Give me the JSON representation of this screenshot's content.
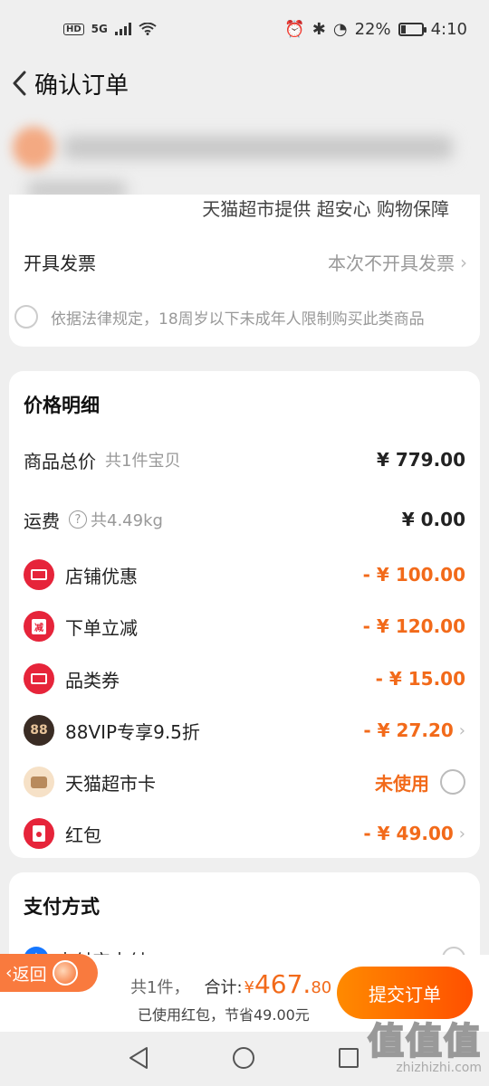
{
  "status_bar": {
    "left_badge": "HD",
    "network": "5G",
    "battery": "22%",
    "time": "4:10"
  },
  "header": {
    "title": "确认订单"
  },
  "card1": {
    "tmall_note": "天猫超市提供 超安心 购物保障",
    "invoice_label": "开具发票",
    "invoice_value": "本次不开具发票",
    "legal_text": "依据法律规定，18周岁以下未成年人限制购买此类商品"
  },
  "price_detail": {
    "title": "价格明细",
    "goods_total": {
      "label": "商品总价",
      "sub": "共1件宝贝",
      "value": "¥ 779.00"
    },
    "shipping": {
      "label": "运费",
      "sub": "共4.49kg",
      "value": "¥ 0.00"
    },
    "discounts": [
      {
        "label": "店铺优惠",
        "value": "- ¥ 100.00",
        "icon": "ticket-icon"
      },
      {
        "label": "下单立减",
        "value": "- ¥ 120.00",
        "icon": "jian-icon",
        "icon_text": "减"
      },
      {
        "label": "品类券",
        "value": "- ¥ 15.00",
        "icon": "ticket-icon"
      },
      {
        "label": "88VIP专享9.5折",
        "value": "- ¥ 27.20",
        "icon": "vip88-icon",
        "icon_text": "88"
      },
      {
        "label": "天猫超市卡",
        "value": "未使用",
        "icon": "card-icon"
      },
      {
        "label": "红包",
        "value": "- ¥ 49.00",
        "icon": "hongbao-icon"
      }
    ]
  },
  "payment": {
    "title": "支付方式",
    "method": "支付宝支付",
    "method_icon_text": "支"
  },
  "bottom_bar": {
    "back_label": "返回",
    "count_text": "共1件，",
    "total_label": "合计:",
    "currency": "¥",
    "total_int": "467.",
    "total_dec": "80",
    "saved_text": "已使用红包，节省49.00元",
    "submit_label": "提交订单"
  },
  "watermark": {
    "logo": "值值值",
    "site": "zhizhizhi.com"
  },
  "colors": {
    "accent": "#f26a1a",
    "submit_start": "#ff8a00",
    "submit_end": "#ff5000",
    "coupon_red": "#e6243a"
  }
}
